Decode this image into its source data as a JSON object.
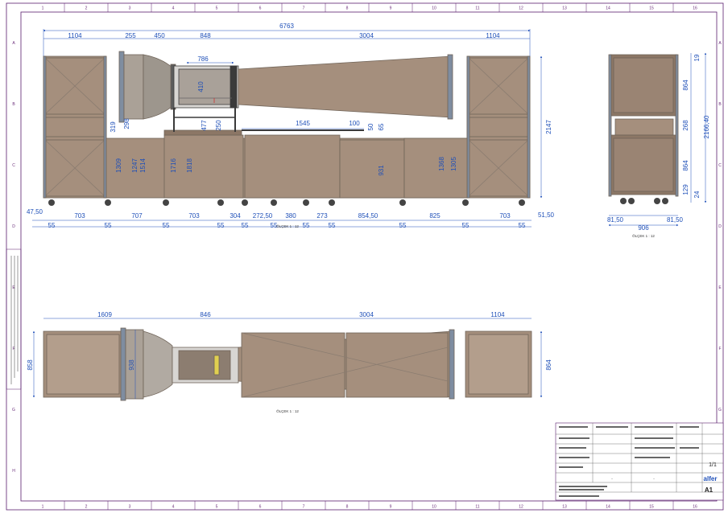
{
  "colors": {
    "frame": "#5a1f6e",
    "dimension": "#1e4fb8",
    "panel": "#a58f7d",
    "panel_dark": "#8c7766",
    "frame_steel": "#7f8da0",
    "chamber": "#9e958a"
  },
  "border": {
    "columns": [
      "1",
      "2",
      "3",
      "4",
      "5",
      "6",
      "7",
      "8",
      "9",
      "10",
      "11",
      "12",
      "13",
      "14",
      "15",
      "16"
    ],
    "rows": [
      "A",
      "B",
      "C",
      "D",
      "E",
      "F",
      "G",
      "H"
    ]
  },
  "front_view": {
    "top_dims": {
      "overall": "6763",
      "segments": [
        "1104",
        "255",
        "450",
        "848",
        "3004",
        "1104"
      ],
      "test_section_inner": "786"
    },
    "vertical_dims": {
      "overall_height": "2147",
      "d319": "319",
      "d298": "298",
      "d1309": "1309",
      "d1247": "1247",
      "d1514": "1514",
      "d1716": "1716",
      "d1818": "1818",
      "d410": "410",
      "d477": "477",
      "d250": "250",
      "d931": "931",
      "d1368": "1368",
      "d1305": "1305",
      "d65": "65",
      "d50": "50"
    },
    "mid_dims": {
      "d1545": "1545",
      "d100": "100"
    },
    "bottom_dims": {
      "left_offset": "47,50",
      "right_offset": "51,50",
      "segments": [
        "703",
        "707",
        "703",
        "304",
        "272,50",
        "380",
        "273",
        "854,50",
        "825",
        "703"
      ],
      "foot": "55"
    },
    "scale_label": "ÖLÇEK 1 : 12"
  },
  "side_view": {
    "dims": {
      "d19": "19",
      "d864_top": "864",
      "d268": "268",
      "overall": "2166,40",
      "d864_bottom": "864",
      "d129": "129",
      "d24": "24",
      "width": "906",
      "left_offset": "81,50",
      "right_offset": "81,50"
    },
    "scale_label": "ÖLÇEK 1 : 12"
  },
  "top_view": {
    "top_dims": [
      "1609",
      "846",
      "3004",
      "1104"
    ],
    "left_dim": "858",
    "inner_dim": "938",
    "right_dim": "864",
    "scale_label": "ÖLÇEK 1 : 12"
  },
  "title_block": {
    "sheet_size": "A1",
    "sheet_number": "1/1",
    "logo_text": "alfer",
    "material": "--",
    "weight": "--"
  }
}
